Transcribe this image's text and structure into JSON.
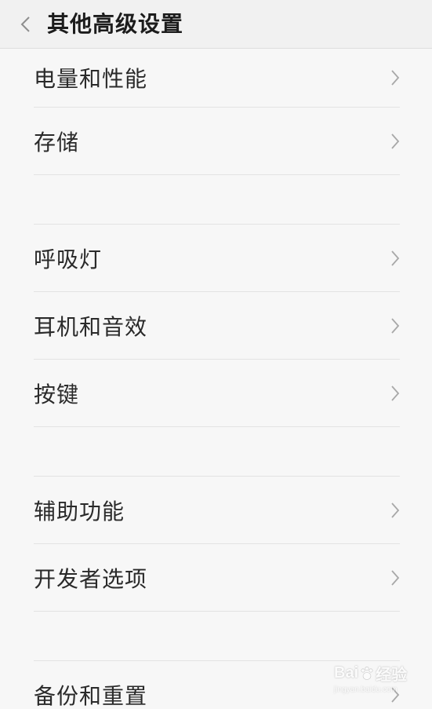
{
  "header": {
    "title": "其他高级设置",
    "back_icon": "back-arrow-icon"
  },
  "groups": [
    {
      "items": [
        {
          "label": "电量和性能"
        },
        {
          "label": "存储"
        }
      ]
    },
    {
      "items": [
        {
          "label": "呼吸灯"
        },
        {
          "label": "耳机和音效"
        },
        {
          "label": "按键"
        }
      ]
    },
    {
      "items": [
        {
          "label": "辅助功能"
        },
        {
          "label": "开发者选项"
        }
      ]
    },
    {
      "items": [
        {
          "label": "备份和重置"
        }
      ]
    }
  ],
  "watermark": {
    "brand_left": "Bai",
    "brand_right": "经验",
    "url": "jingyan.baidu.com"
  },
  "colors": {
    "background": "#f7f7f7",
    "header": "#f1f1f1",
    "text": "#2a2a2a",
    "divider": "#e3e3e3",
    "chevron": "#a8a8a8"
  }
}
